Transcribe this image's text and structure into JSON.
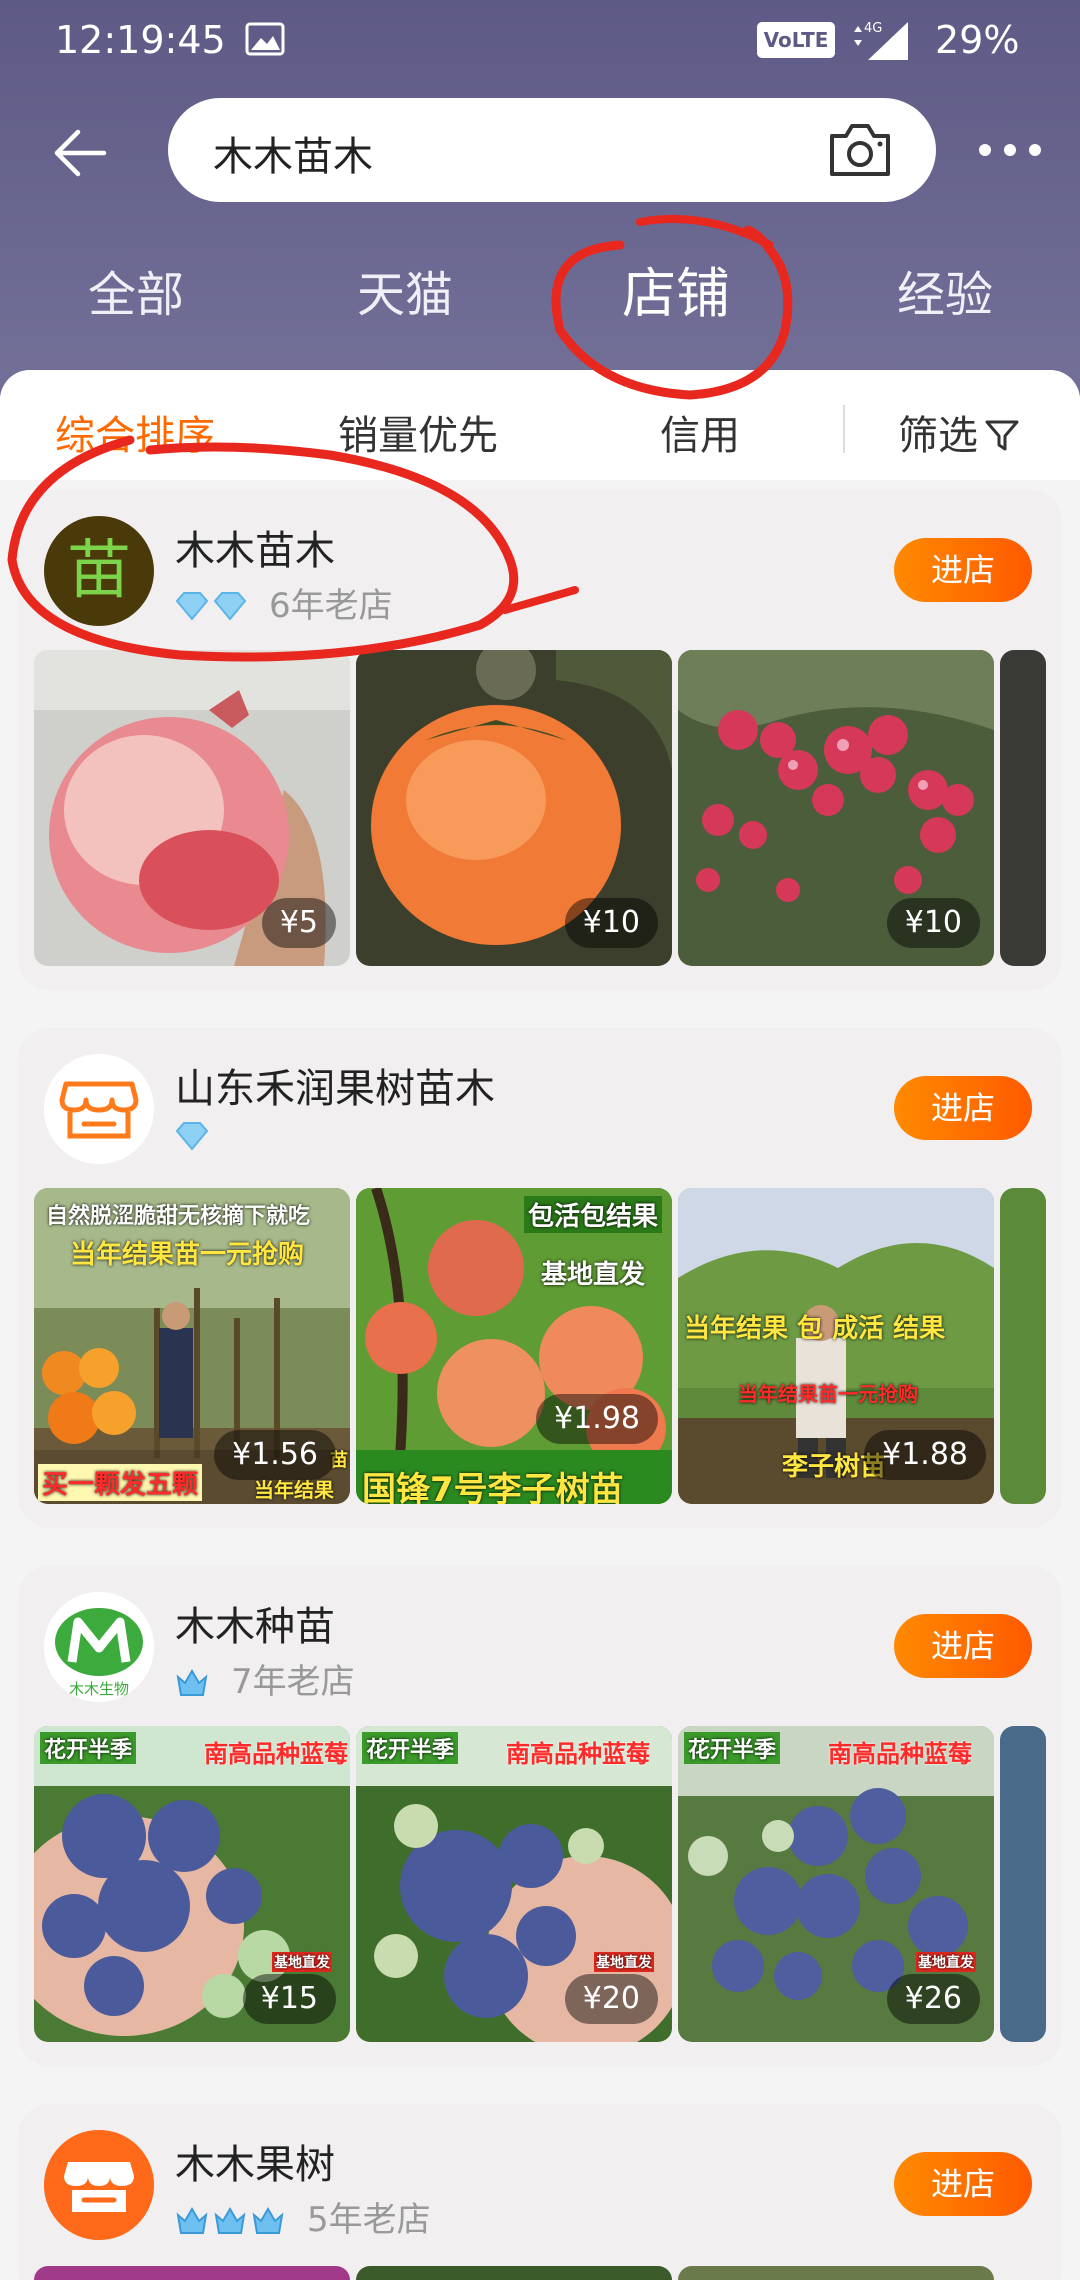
{
  "status_bar": {
    "time": "12:19:45",
    "volte": "VoLTE",
    "network": "4G",
    "battery": "29%"
  },
  "search": {
    "query": "木木苗木"
  },
  "tabs": [
    "全部",
    "天猫",
    "店铺",
    "经验"
  ],
  "active_tab": "店铺",
  "sort": {
    "items": [
      "综合排序",
      "销量优先",
      "信用",
      "筛选"
    ],
    "active": "综合排序"
  },
  "enter_label": "进店",
  "shops": [
    {
      "name": "木木苗木",
      "avatar_text": "苗",
      "gems": 2,
      "age": "6年老店",
      "products": [
        {
          "price": "¥5",
          "subject": "pomegranate"
        },
        {
          "price": "¥10",
          "subject": "persimmon"
        },
        {
          "price": "¥10",
          "subject": "hawthorn"
        }
      ]
    },
    {
      "name": "山东禾润果树苗木",
      "avatar_text": "",
      "gems": 1,
      "age": "",
      "products": [
        {
          "price": "¥1.56",
          "subject": "persimmon-seedling",
          "captions": [
            "自然脱涩脆甜无核摘下就吃",
            "当年结果苗一元抢购",
            "买一颗发五颗",
            "当年结果",
            "苗"
          ]
        },
        {
          "price": "¥1.98",
          "subject": "plum",
          "captions": [
            "包活包结果",
            "基地直发",
            "国锋7号李子树苗"
          ]
        },
        {
          "price": "¥1.88",
          "subject": "plum-seedling",
          "captions": [
            "当年结果 包 成活 结果",
            "当年结果苗一元抢购",
            "李子树苗"
          ]
        }
      ]
    },
    {
      "name": "木木种苗",
      "avatar_text": "木木生物",
      "gems": 1,
      "age": "7年老店",
      "products": [
        {
          "price": "¥15",
          "subject": "blueberry",
          "captions": [
            "南高品种蓝莓",
            "基地直发"
          ]
        },
        {
          "price": "¥20",
          "subject": "blueberry",
          "captions": [
            "南高品种蓝莓",
            "基地直发"
          ]
        },
        {
          "price": "¥26",
          "subject": "blueberry",
          "captions": [
            "南高品种蓝莓",
            "基地直发"
          ]
        }
      ]
    },
    {
      "name": "木木果树",
      "avatar_text": "",
      "gems": 3,
      "age": "5年老店",
      "products": []
    }
  ],
  "colors": {
    "accent": "#ff6a00",
    "header": "#5e5a86",
    "annotation": "#e8281e"
  }
}
